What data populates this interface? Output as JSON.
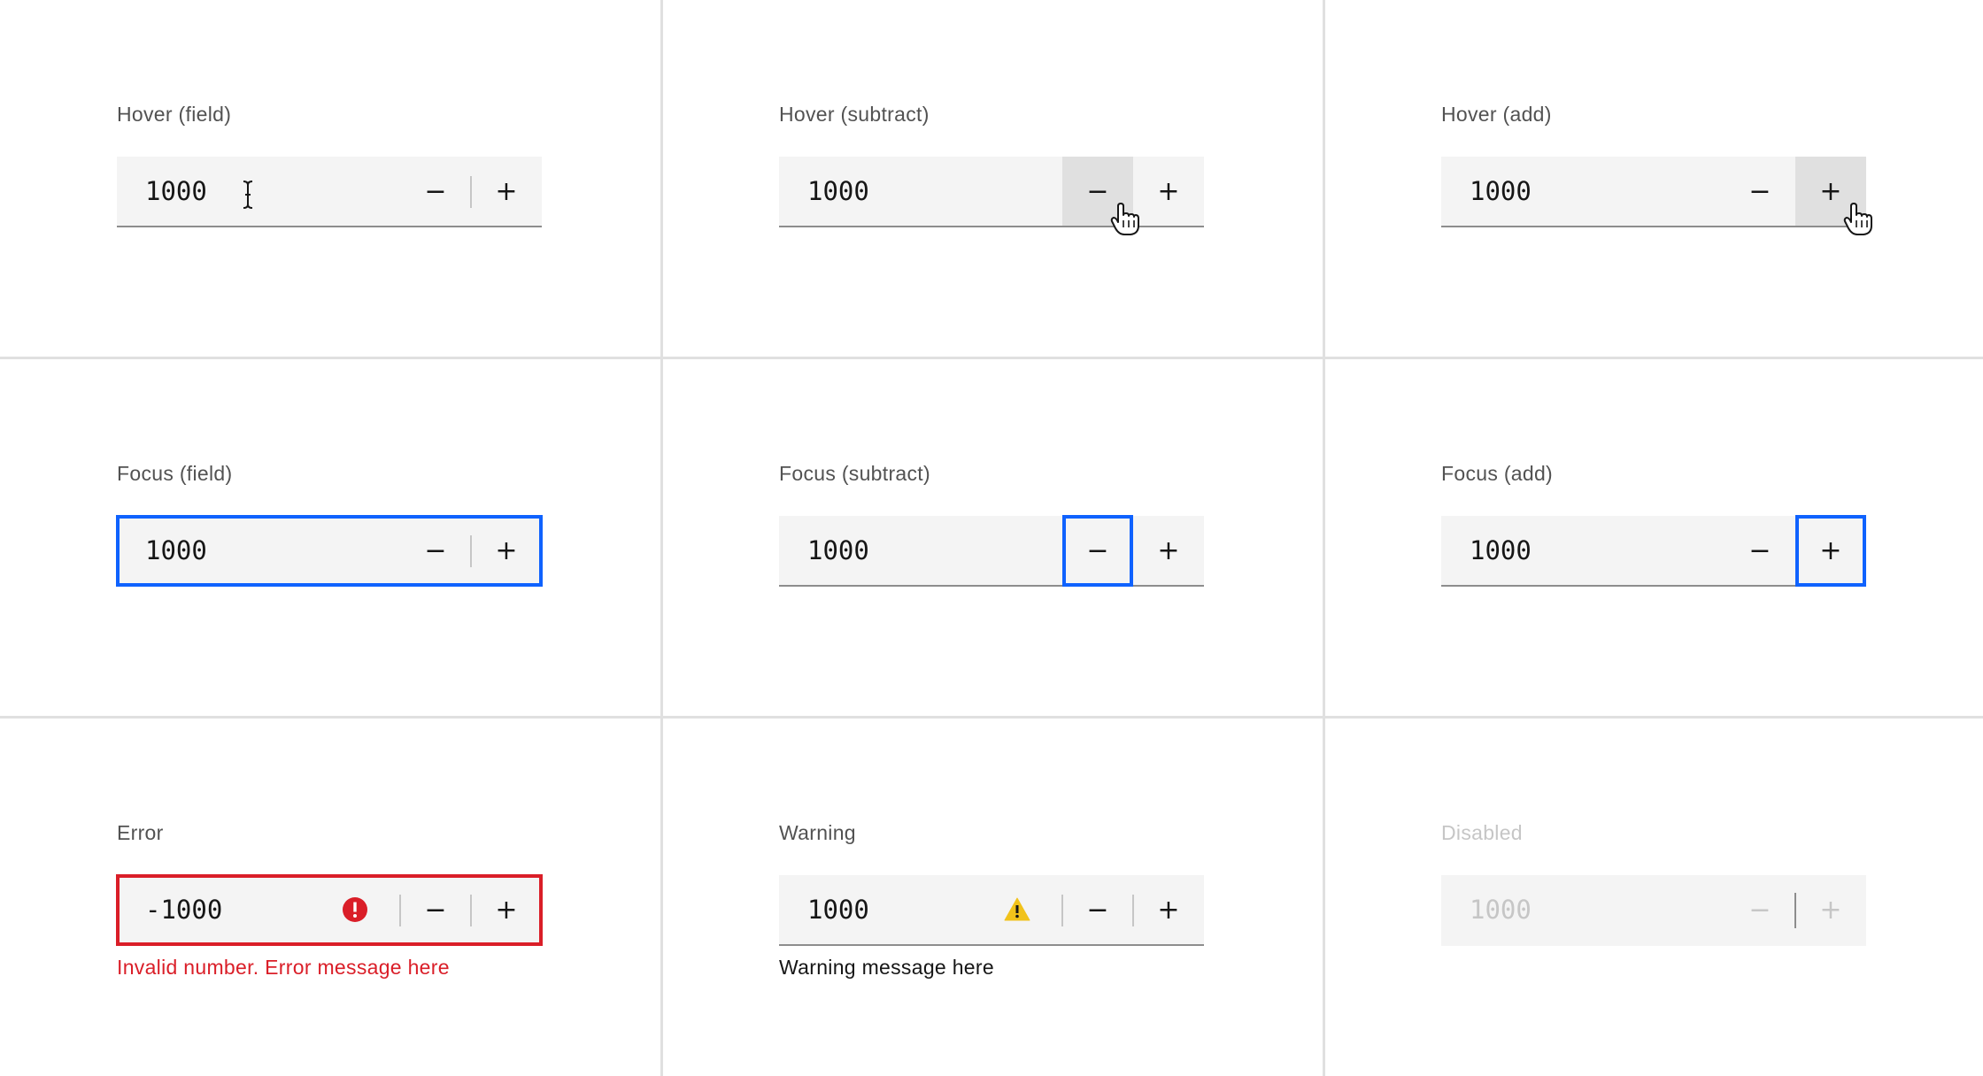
{
  "cells": {
    "hover_field": {
      "label": "Hover (field)",
      "value": "1000"
    },
    "hover_sub": {
      "label": "Hover (subtract)",
      "value": "1000"
    },
    "hover_add": {
      "label": "Hover (add)",
      "value": "1000"
    },
    "focus_field": {
      "label": "Focus (field)",
      "value": "1000"
    },
    "focus_sub": {
      "label": "Focus (subtract)",
      "value": "1000"
    },
    "focus_add": {
      "label": "Focus (add)",
      "value": "1000"
    },
    "error": {
      "label": "Error",
      "value": "-1000",
      "helper": "Invalid number. Error message here"
    },
    "warning": {
      "label": "Warning",
      "value": "1000",
      "helper": "Warning message here"
    },
    "disabled": {
      "label": "Disabled",
      "value": "1000"
    }
  },
  "buttons": {
    "decrement": "−",
    "increment": "+"
  },
  "icons": {
    "error": "error-filled-icon",
    "warning": "warning-alt-icon",
    "text_cursor": "i-beam-cursor-icon",
    "pointer": "hand-pointer-icon"
  },
  "colors": {
    "focus": "#0f62fe",
    "error": "#da1e28",
    "warning": "#f1c21b",
    "field_bg": "#f4f4f4",
    "hover_bg": "#e0e0e0",
    "disabled_text": "#c6c6c6"
  }
}
